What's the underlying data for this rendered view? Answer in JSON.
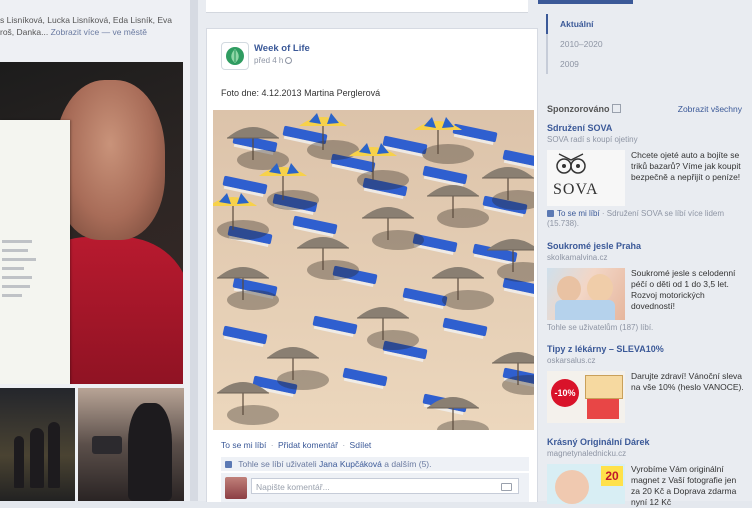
{
  "left": {
    "friends_line1": "s Lisníková, Lucka Lisníková, Eda Lisník, Eva",
    "friends_line2_prefix": "roš, Danka...",
    "friends_more": "Zobrazit více — ve městě"
  },
  "post": {
    "page_name": "Week of Life",
    "time": "před 4 h",
    "text": "Foto dne: 4.12.2013 Martina Perglerová",
    "actions": {
      "like": "To se mi líbí",
      "comment": "Přidat komentář",
      "share": "Sdílet",
      "separator": "·"
    },
    "likes": {
      "prefix": "Tohle se líbí uživateli",
      "user": "Jana Kupčáková",
      "suffix": "a dalším (5)."
    },
    "comment_placeholder": "Napište komentář..."
  },
  "timeline_nav": [
    {
      "label": "Aktuální",
      "active": true
    },
    {
      "label": "2010–2020",
      "active": false
    },
    {
      "label": "2009",
      "active": false
    }
  ],
  "sponsored": {
    "title": "Sponzorováno",
    "all_link": "Zobrazit všechny",
    "ads": [
      {
        "title": "Sdružení SOVA",
        "domain": "SOVA radí s koupí ojetiny",
        "body": "Chcete ojeté auto a bojíte se triků bazarů? Víme jak koupit bezpečně a nepřijít o peníze!",
        "logo_text": "SOVA",
        "like_text": "To se mi líbí",
        "social": "Sdružení SOVA se líbí více lidem (15.738)."
      },
      {
        "title": "Soukromé jesle Praha",
        "domain": "skolkamalvina.cz",
        "body": "Soukromé jesle s celodenní péčí o děti od 1 do 3,5 let. Rozvoj motorických dovedností!",
        "social": "Tohle se uživatelům (187) líbí."
      },
      {
        "title": "Tipy z lékárny – SLEVA10%",
        "domain": "oskarsalus.cz",
        "body": "Darujte zdraví! Vánoční sleva na vše 10% (heslo VANOCE).",
        "badge": "-10%"
      },
      {
        "title": "Krásný Originální Dárek",
        "domain": "magnetynalednicku.cz",
        "body": "Vyrobíme Vám originální magnet z Vaší fotografie jen za 20 Kč a Doprava zdarma nyní 12 Kč",
        "price_badge": "20"
      }
    ]
  }
}
